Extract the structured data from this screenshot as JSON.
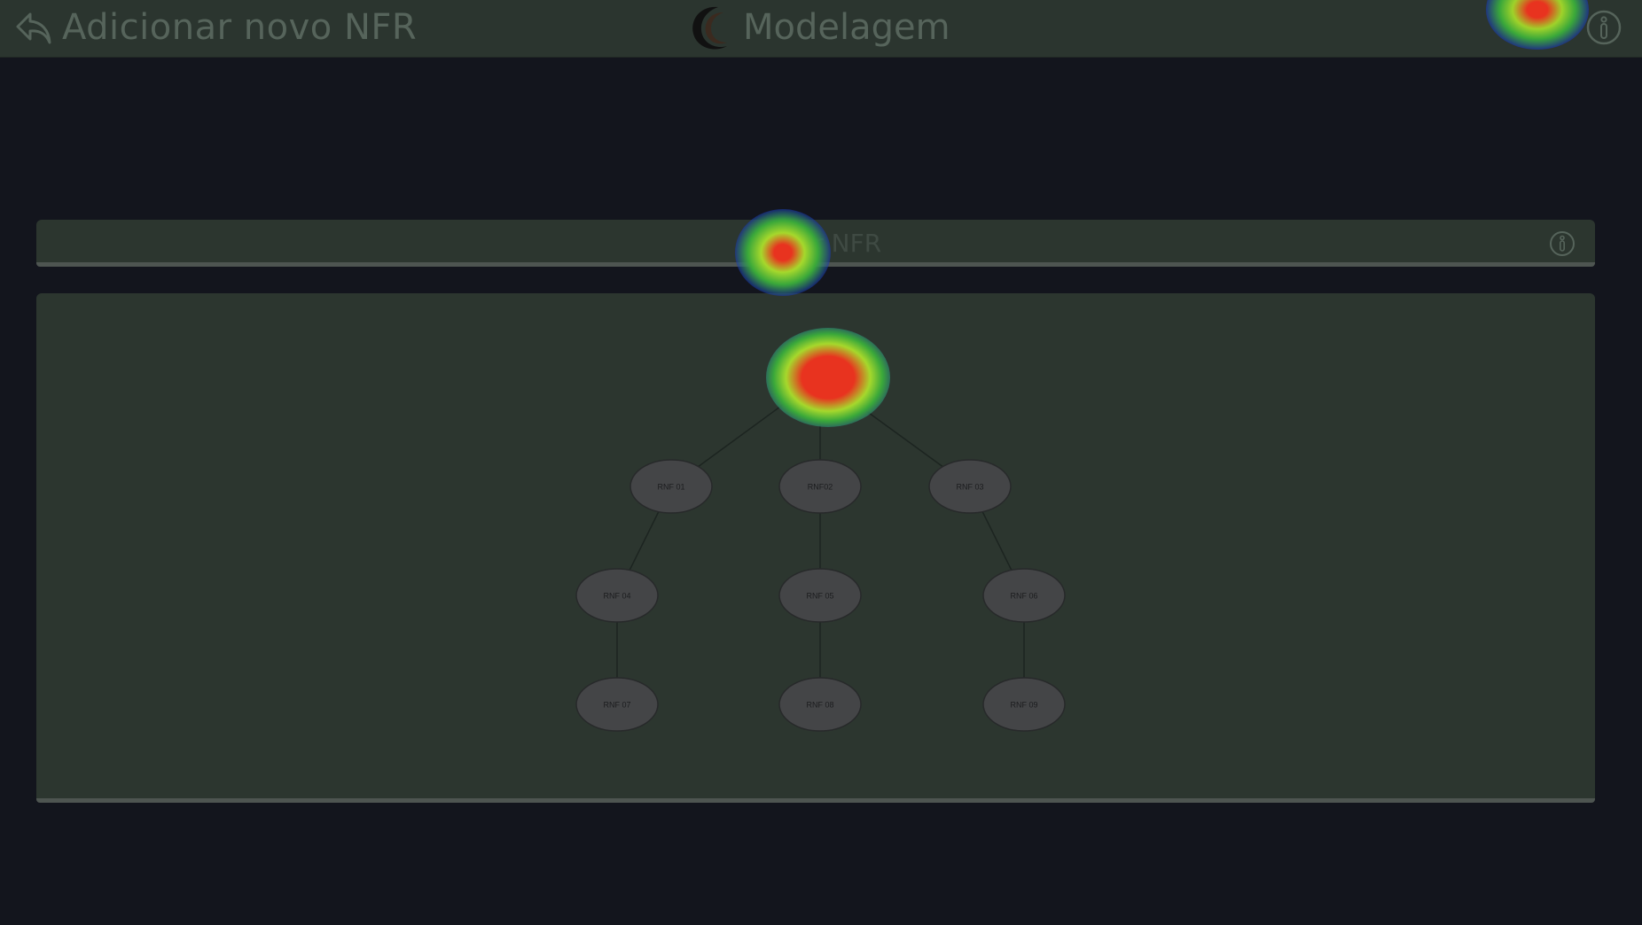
{
  "topbar": {
    "title": "Adicionar novo NFR",
    "app_name": "Modelagem",
    "back_icon": "back-arrow-icon",
    "logo_icon": "app-logo-icon",
    "info_icon": "info-icon"
  },
  "panel": {
    "title": "Editar NFR",
    "info_icon": "info-icon"
  },
  "tree": {
    "nodes": [
      {
        "id": "root",
        "label": ""
      },
      {
        "id": "n1",
        "label": "RNF 01"
      },
      {
        "id": "n2",
        "label": "RNF02"
      },
      {
        "id": "n3",
        "label": "RNF 03"
      },
      {
        "id": "n4",
        "label": "RNF 04"
      },
      {
        "id": "n5",
        "label": "RNF 05"
      },
      {
        "id": "n6",
        "label": "RNF 06"
      },
      {
        "id": "n7",
        "label": "RNF 07"
      },
      {
        "id": "n8",
        "label": "RNF 08"
      },
      {
        "id": "n9",
        "label": "RNF 09"
      }
    ],
    "edges": [
      [
        "root",
        "n1"
      ],
      [
        "root",
        "n2"
      ],
      [
        "root",
        "n3"
      ],
      [
        "n1",
        "n4"
      ],
      [
        "n2",
        "n5"
      ],
      [
        "n3",
        "n6"
      ],
      [
        "n4",
        "n7"
      ],
      [
        "n5",
        "n8"
      ],
      [
        "n6",
        "n9"
      ]
    ]
  },
  "colors": {
    "background": "#13151d",
    "panel": "#2c362f",
    "node_fill": "#444547"
  }
}
